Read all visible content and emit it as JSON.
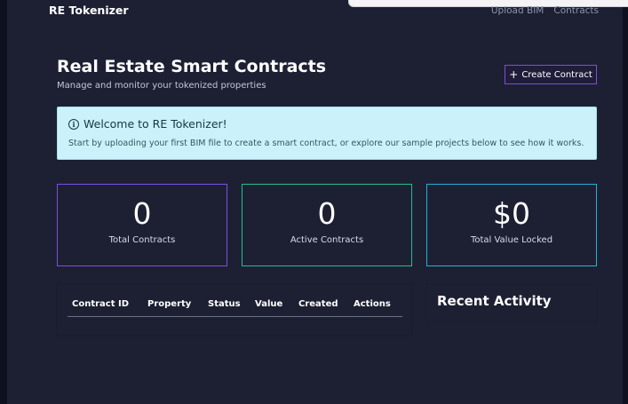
{
  "header": {
    "brand": "RE Tokenizer",
    "nav": [
      "Upload BIM",
      "Contracts"
    ]
  },
  "page": {
    "title": "Real Estate Smart Contracts",
    "subtitle": "Manage and monitor your tokenized properties",
    "create_button": "Create Contract"
  },
  "banner": {
    "title": "Welcome to RE Tokenizer!",
    "text": "Start by uploading your first BIM file to create a smart contract, or explore our sample projects below to see how it works."
  },
  "stats": [
    {
      "value": "0",
      "label": "Total Contracts"
    },
    {
      "value": "0",
      "label": "Active Contracts"
    },
    {
      "value": "$0",
      "label": "Total Value Locked"
    }
  ],
  "table": {
    "columns": [
      "Contract ID",
      "Property",
      "Status",
      "Value",
      "Created",
      "Actions"
    ]
  },
  "activity": {
    "title": "Recent Activity"
  },
  "colors": {
    "background": "#1d2033",
    "accent_purple": "#7c4ddf",
    "accent_green": "#21c08b",
    "accent_cyan": "#1fb3d6",
    "banner_bg": "#cbf2fa"
  }
}
